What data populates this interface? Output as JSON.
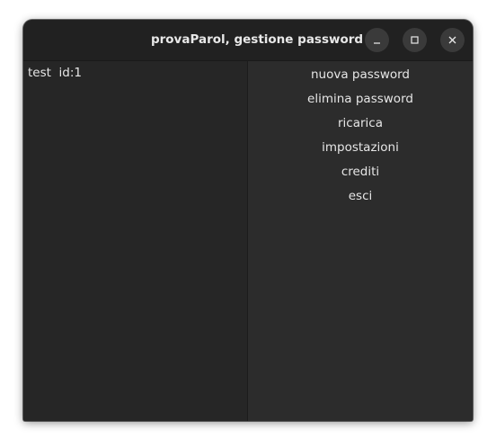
{
  "window": {
    "title": "provaParol, gestione password",
    "controls": {
      "minimize": "minimize-icon",
      "maximize": "maximize-icon",
      "close": "close-icon"
    }
  },
  "password_list": {
    "items": [
      {
        "label": "test  id:1"
      }
    ]
  },
  "menu": {
    "items": [
      {
        "label": "nuova password"
      },
      {
        "label": "elimina password"
      },
      {
        "label": "ricarica"
      },
      {
        "label": "impostazioni"
      },
      {
        "label": "crediti"
      },
      {
        "label": "esci"
      }
    ]
  },
  "colors": {
    "window_bg": "#2b2b2b",
    "titlebar_bg": "#212121",
    "text": "#e6e6e6"
  }
}
